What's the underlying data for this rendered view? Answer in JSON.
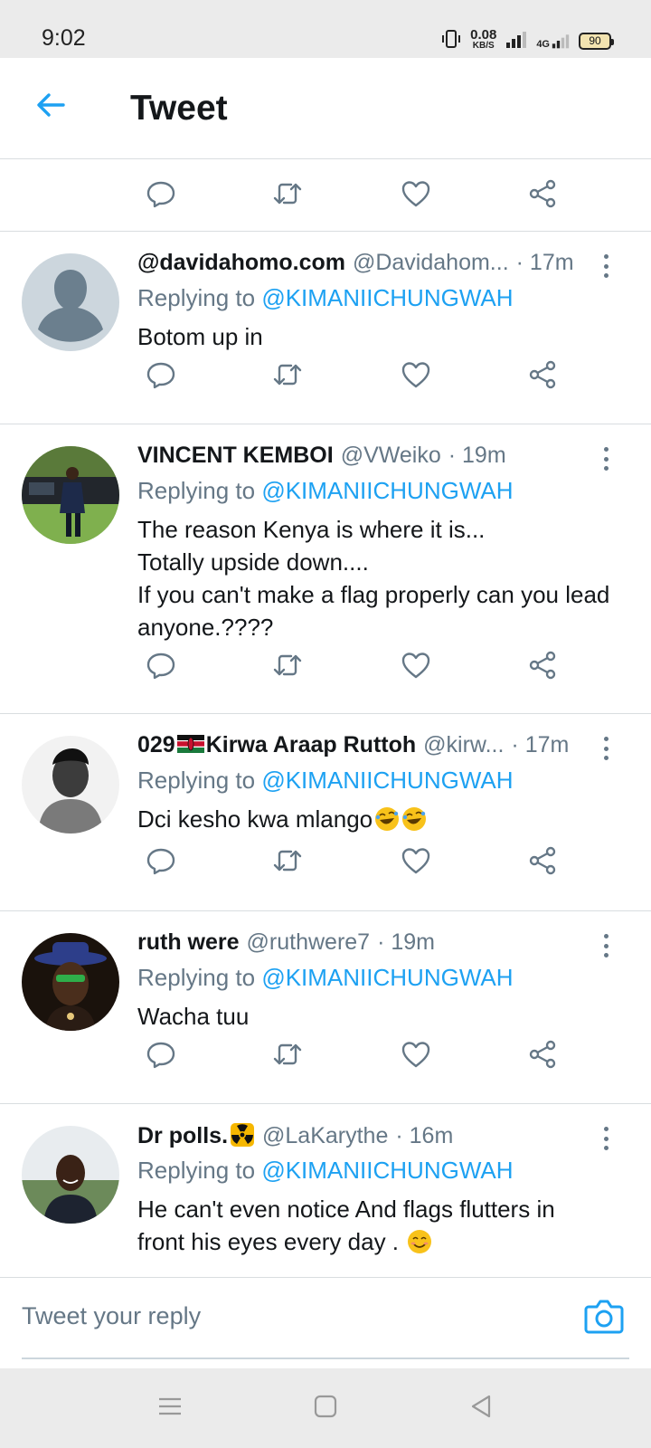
{
  "status_bar": {
    "time": "9:02",
    "net_speed_value": "0.08",
    "net_speed_unit": "KB/S",
    "network_type": "4G",
    "battery": "90"
  },
  "header": {
    "title": "Tweet",
    "back_icon": "arrow-left-icon"
  },
  "colors": {
    "accent": "#1da1f2",
    "secondary_text": "#657786",
    "divider": "#d9dde0",
    "system_bar": "#ebebeb"
  },
  "action_icons": [
    "reply-icon",
    "retweet-icon",
    "like-icon",
    "share-icon"
  ],
  "replies": [
    {
      "display_name": "@davidahomo.com",
      "handle": "@Davidahom...",
      "time": "· 17m",
      "replying_prefix": "Replying to",
      "replying_to": "@KIMANIICHUNGWAH",
      "text_lines": [
        "Botom up in"
      ]
    },
    {
      "display_name": "VINCENT KEMBOI",
      "handle": "@VWeiko",
      "time": "· 19m",
      "replying_prefix": "Replying to",
      "replying_to": "@KIMANIICHUNGWAH",
      "text_lines": [
        "The reason Kenya is where it is...",
        "Totally upside down....",
        "If you can't make a flag properly can you lead",
        "anyone.????"
      ]
    },
    {
      "display_name_prefix": "029",
      "display_name": "Kirwa Araap Ruttoh",
      "handle": "@kirw...",
      "time": "· 17m",
      "replying_prefix": "Replying to",
      "replying_to": "@KIMANIICHUNGWAH",
      "text_lines": [
        "Dci kesho kwa mlango"
      ],
      "emojis": [
        "rolling-laughing-emoji",
        "rolling-laughing-emoji"
      ]
    },
    {
      "display_name": "ruth were",
      "handle": "@ruthwere7",
      "time": "· 19m",
      "replying_prefix": "Replying to",
      "replying_to": "@KIMANIICHUNGWAH",
      "text_lines": [
        "Wacha tuu"
      ]
    },
    {
      "display_name": "Dr polls.",
      "handle": "@LaKarythe",
      "time": "· 16m",
      "replying_prefix": "Replying to",
      "replying_to": "@KIMANIICHUNGWAH",
      "text_lines": [
        "He can't even notice And  flags flutters in",
        "front his eyes every day ."
      ],
      "emojis": [
        "radioactive-emoji",
        "smiling-face-emoji"
      ]
    }
  ],
  "composer": {
    "placeholder": "Tweet your reply",
    "camera_icon": "camera-icon"
  },
  "nav_bar": {
    "icons": [
      "menu-icon",
      "home-square-icon",
      "back-triangle-icon"
    ]
  }
}
